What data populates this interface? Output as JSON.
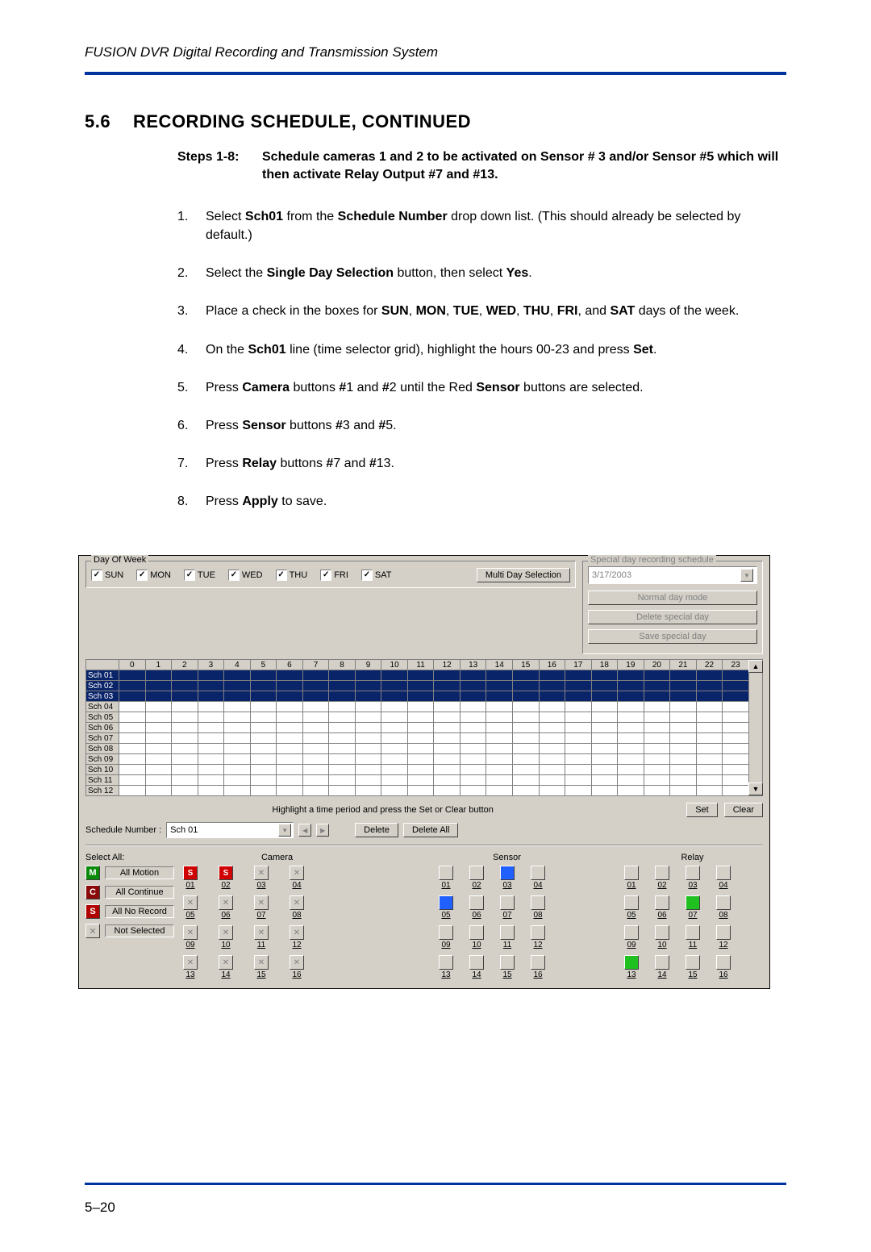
{
  "header": {
    "running": "FUSION DVR Digital Recording and Transmission System"
  },
  "section": {
    "number": "5.6",
    "title": "RECORDING SCHEDULE, CONTINUED"
  },
  "intro": {
    "label": "Steps 1-8:",
    "text": "Schedule cameras 1 and 2 to be activated on Sensor # 3 and/or Sensor #5 which will then activate Relay Output #7 and #13."
  },
  "steps": [
    "Select <b>Sch01</b> from the <b>Schedule Number</b> drop down list. (This should already be selected by default.)",
    "Select the <b>Single Day Selection</b> button, then select <b>Yes</b>.",
    "Place a check in the boxes for <b>SUN</b>, <b>MON</b>, <b>TUE</b>, <b>WED</b>, <b>THU</b>, <b>FRI</b>, and <b>SAT</b> days of the week.",
    "On the <b>Sch01</b> line (time selector grid), highlight the hours 00-23 and press <b>Set</b>.",
    "Press <b>Camera</b> buttons <b>#</b>1 and <b>#</b>2 until the Red <b>Sensor</b> buttons are selected.",
    "Press <b>Sensor</b> buttons <b>#</b>3 and <b>#</b>5.",
    "Press <b>Relay</b> buttons <b>#</b>7 and <b>#</b>13.",
    "Press <b>Apply</b> to save."
  ],
  "footer": {
    "page": "5–20"
  },
  "ui": {
    "dow": {
      "title": "Day Of Week",
      "days": [
        "SUN",
        "MON",
        "TUE",
        "WED",
        "THU",
        "FRI",
        "SAT"
      ],
      "multiday": "Multi Day Selection"
    },
    "special": {
      "title": "Special day recording schedule",
      "date": "3/17/2003",
      "normal": "Normal day mode",
      "delete": "Delete special day",
      "save": "Save special day"
    },
    "grid": {
      "hours": [
        "0",
        "1",
        "2",
        "3",
        "4",
        "5",
        "6",
        "7",
        "8",
        "9",
        "10",
        "11",
        "12",
        "13",
        "14",
        "15",
        "16",
        "17",
        "18",
        "19",
        "20",
        "21",
        "22",
        "23"
      ],
      "rows": [
        "Sch 01",
        "Sch 02",
        "Sch 03",
        "Sch 04",
        "Sch 05",
        "Sch 06",
        "Sch 07",
        "Sch 08",
        "Sch 09",
        "Sch 10",
        "Sch 11",
        "Sch 12"
      ],
      "selected_rows": [
        0,
        1,
        2
      ],
      "hint": "Highlight a time period and press the Set or Clear button",
      "set": "Set",
      "clear": "Clear"
    },
    "schedule_number": {
      "label": "Schedule Number :",
      "value": "Sch 01",
      "delete": "Delete",
      "delete_all": "Delete All"
    },
    "headers": {
      "select_all": "Select All:",
      "camera": "Camera",
      "sensor": "Sensor",
      "relay": "Relay"
    },
    "select_all": {
      "all_motion": "All Motion",
      "all_continue": "All Continue",
      "all_no_record": "All No Record",
      "not_selected": "Not Selected"
    },
    "camera": {
      "labels": [
        "01",
        "02",
        "03",
        "04",
        "05",
        "06",
        "07",
        "08",
        "09",
        "10",
        "11",
        "12",
        "13",
        "14",
        "15",
        "16"
      ],
      "states": [
        "s-red",
        "s-red",
        "x",
        "x",
        "x",
        "x",
        "x",
        "x",
        "x",
        "x",
        "x",
        "x",
        "x",
        "x",
        "x",
        "x"
      ]
    },
    "sensor": {
      "labels": [
        "01",
        "02",
        "03",
        "04",
        "05",
        "06",
        "07",
        "08",
        "09",
        "10",
        "11",
        "12",
        "13",
        "14",
        "15",
        "16"
      ],
      "states": [
        "box",
        "box",
        "blue",
        "box",
        "blue",
        "box",
        "box",
        "box",
        "box",
        "box",
        "box",
        "box",
        "box",
        "box",
        "box",
        "box"
      ]
    },
    "relay": {
      "labels": [
        "01",
        "02",
        "03",
        "04",
        "05",
        "06",
        "07",
        "08",
        "09",
        "10",
        "11",
        "12",
        "13",
        "14",
        "15",
        "16"
      ],
      "states": [
        "box",
        "box",
        "box",
        "box",
        "box",
        "box",
        "green",
        "box",
        "box",
        "box",
        "box",
        "box",
        "green",
        "box",
        "box",
        "box"
      ]
    }
  }
}
